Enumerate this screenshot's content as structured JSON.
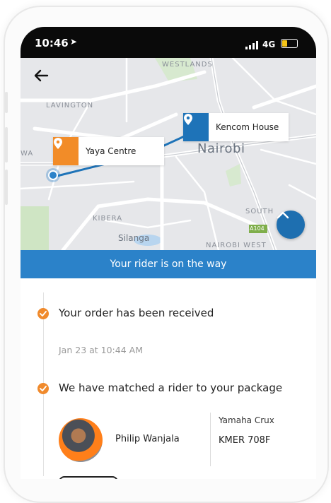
{
  "status_bar": {
    "time": "10:46",
    "network": "4G"
  },
  "map": {
    "labels": {
      "westlands": "WESTLANDS",
      "lavington": "LAVINGTON",
      "kibera": "KIBERA",
      "silanga": "Silanga",
      "nairobi": "Nairobi",
      "nairobi_west": "NAIROBI WEST",
      "south": "SOUTH",
      "road_sign": "A104",
      "edge": "WA"
    },
    "pins": {
      "destination": {
        "label": "Kencom House",
        "icon": "location-pin-icon",
        "color": "#1e73b8"
      },
      "origin": {
        "label": "Yaya Centre",
        "icon": "location-pin-icon",
        "color": "#f28c28"
      }
    }
  },
  "banner": {
    "text": "Your rider is on the way",
    "color": "#2b82c9"
  },
  "timeline": {
    "steps": [
      {
        "title": "Your order has been received",
        "subtitle": "Jan 23 at 10:44 AM"
      },
      {
        "title": "We have matched a rider to your package"
      }
    ]
  },
  "rider": {
    "name": "Philip Wanjala",
    "vehicle_model": "Yamaha Crux",
    "plate": "KMER 708F"
  },
  "colors": {
    "accent": "#f08a2c",
    "primary": "#2b82c9"
  }
}
